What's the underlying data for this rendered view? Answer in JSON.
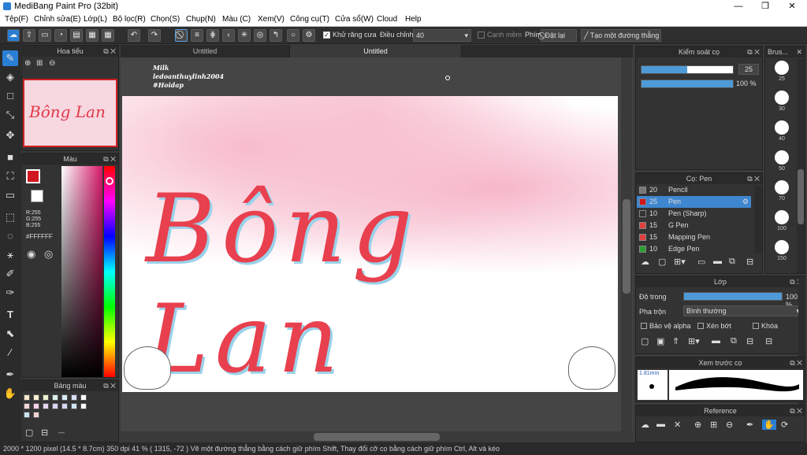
{
  "app": {
    "title": "MediBang Paint Pro (32bit)"
  },
  "window_buttons": {
    "min": "—",
    "max": "❐",
    "close": "✕"
  },
  "menu": [
    "Tệp(F)",
    "Chỉnh sửa(E)",
    "Lớp(L)",
    "Bộ lọc(R)",
    "Chọn(S)",
    "Chụp(N)",
    "Màu (C)",
    "Xem(V)",
    "Công cụ(T)",
    "Cửa sổ(W)",
    "Cloud",
    "Help"
  ],
  "toolbar": {
    "antialias": "Khử răng cưa",
    "adjust_label": "Điều chỉnh",
    "adjust_value": "40",
    "edge_label": "Cạnh mềm",
    "key_label": "Phím",
    "reset_label": "Đặt lại",
    "line_label": "Tạo một đường thẳng"
  },
  "navigator": {
    "title": "Hoa tiểu"
  },
  "color_panel": {
    "title": "Màu",
    "r": "R:255",
    "g": "G:255",
    "b": "B:255",
    "hex": "#FFFFFF",
    "fg": "#d0161e",
    "bg": "#ffffff"
  },
  "palette": {
    "title": "Bảng màu",
    "footer": "---",
    "swatches": [
      "#f7e9c9",
      "#fbf1cf",
      "#e9f2d0",
      "#d9f1e9",
      "#d6ecf6",
      "#d7e0f6",
      "#fff",
      "#f8d6d6",
      "#f6d0e6",
      "#e7d3f2",
      "#dad6f3",
      "#d5d9f1",
      "#cde6f4",
      "#fff",
      "#c8e4ef",
      "#f4d0d0"
    ]
  },
  "tabs": [
    "Untitled",
    "Untitled"
  ],
  "canvas": {
    "signature": [
      "Milk",
      "ledoanthuylinh2004",
      "#Hoidap"
    ],
    "title_text": "Bông Lan"
  },
  "brush_control": {
    "title": "Kiểm soát cọ",
    "size": "25",
    "opacity": "100 %",
    "size_fill": 0.5,
    "opacity_fill": 1.0
  },
  "brush_sizes": {
    "title": "Brus...",
    "labels": [
      "25",
      "30",
      "40",
      "50",
      "70",
      "100",
      "150"
    ]
  },
  "brushes": {
    "title": "Cọ: Pen",
    "items": [
      {
        "size": "20",
        "name": "Pencil",
        "color": "#777"
      },
      {
        "size": "25",
        "name": "Pen",
        "color": "#d0161e",
        "selected": true
      },
      {
        "size": "10",
        "name": "Pen (Sharp)",
        "color": "#333"
      },
      {
        "size": "15",
        "name": "G Pen",
        "color": "#e04040"
      },
      {
        "size": "15",
        "name": "Mapping Pen",
        "color": "#e04040"
      },
      {
        "size": "10",
        "name": "Edge Pen",
        "color": "#2aa030"
      }
    ]
  },
  "layer": {
    "title": "Lớp",
    "opacity_label": "Độ trong",
    "opacity_value": "100 %",
    "blend_label": "Pha trộn",
    "blend_value": "Bình thường",
    "protect_alpha": "Bảo vệ alpha",
    "clip": "Xén bớt",
    "lock": "Khóa"
  },
  "preview": {
    "title": "Xem trước cọ",
    "size": "1.81mm"
  },
  "reference": {
    "title": "Reference"
  },
  "status": {
    "text": "2000 * 1200 pixel   (14.5 * 8.7cm)   350 dpi   41 %   ( 1315, -72 )   Vẽ một đường thẳng bằng cách giữ phím Shift, Thay đổi cỡ cọ bằng cách giữ phím Ctrl, Alt và kéo"
  }
}
